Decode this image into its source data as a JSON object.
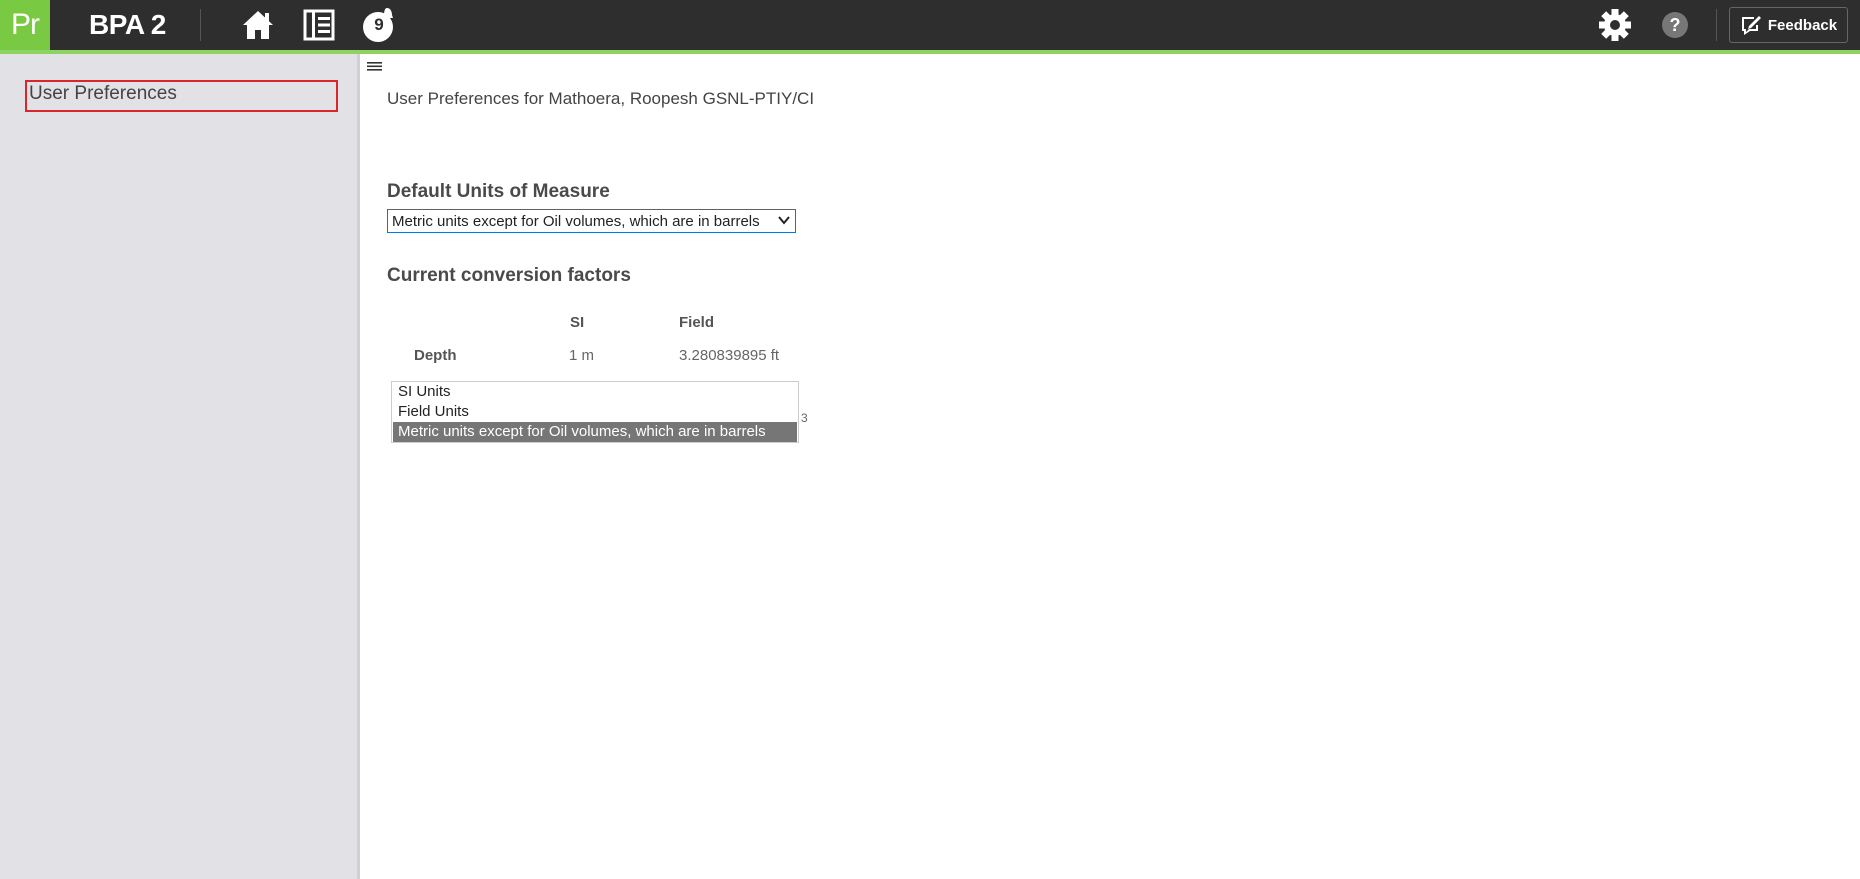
{
  "header": {
    "logo": "Pr",
    "app_title": "BPA 2",
    "notification_count": "9",
    "feedback_label": "Feedback",
    "icons": [
      "home-icon",
      "list-icon",
      "notification-icon",
      "gear-icon",
      "help-icon",
      "feedback-icon"
    ],
    "accent_color": "#8dd35f",
    "bar_color": "#2e2e2e"
  },
  "sidebar": {
    "items": [
      {
        "label": "User Preferences"
      }
    ]
  },
  "main": {
    "title": "User Preferences for Mathoera, Roopesh GSNL-PTIY/CI",
    "default_units_heading": "Default Units of Measure",
    "units_select": {
      "selected": "Metric units except for Oil volumes, which are in barrels",
      "options": [
        "SI Units",
        "Field Units",
        "Metric units except for Oil volumes, which are in barrels"
      ]
    },
    "conversion_heading": "Current conversion factors",
    "table": {
      "headers": [
        "",
        "SI",
        "Field"
      ],
      "rows": [
        {
          "label": "Depth",
          "si": "1 m",
          "field": "3.280839895 ft"
        }
      ]
    },
    "trailing_digit": "3"
  }
}
